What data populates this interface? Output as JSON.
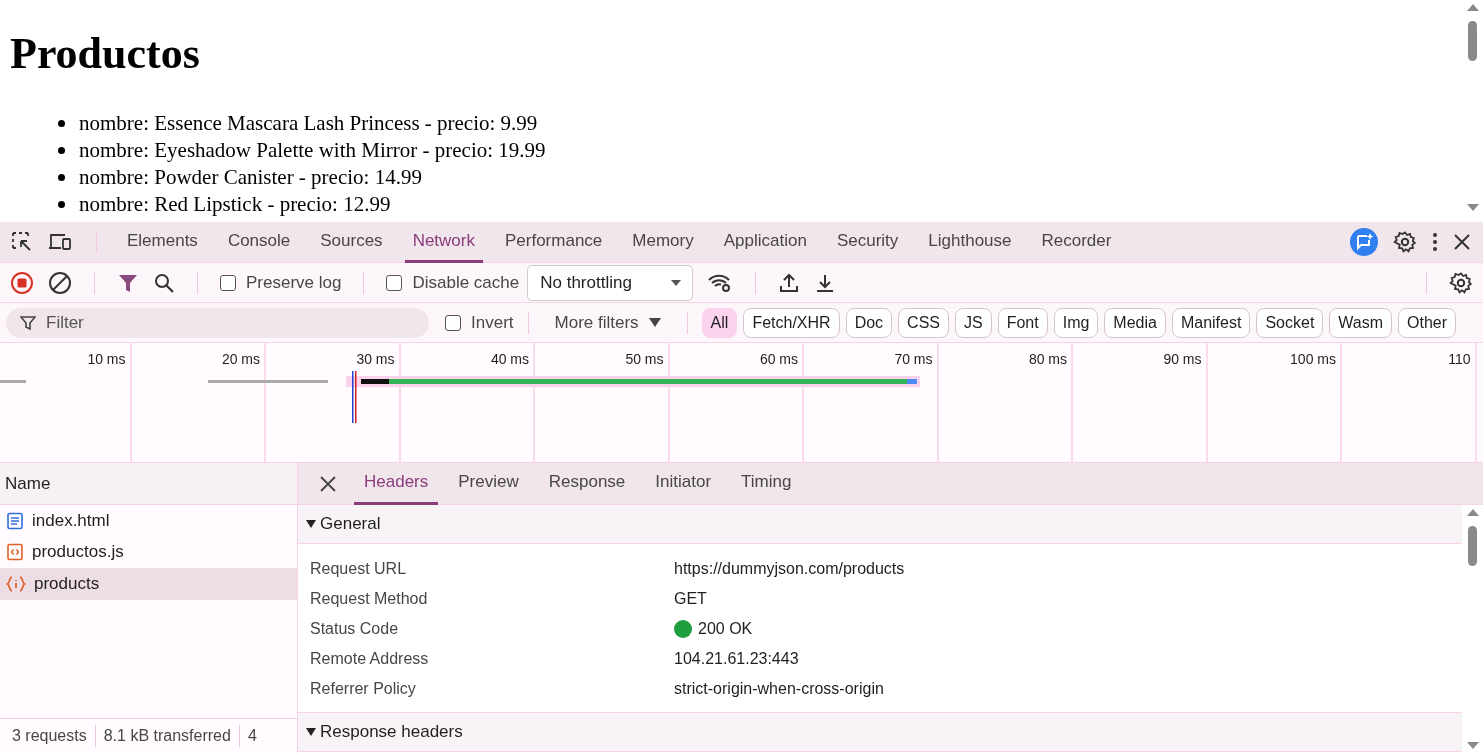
{
  "page": {
    "title": "Productos",
    "items": [
      "nombre: Essence Mascara Lash Princess - precio: 9.99",
      "nombre: Eyeshadow Palette with Mirror - precio: 19.99",
      "nombre: Powder Canister - precio: 14.99",
      "nombre: Red Lipstick - precio: 12.99"
    ]
  },
  "devtools": {
    "tabs": [
      {
        "label": "Elements",
        "selected": false
      },
      {
        "label": "Console",
        "selected": false
      },
      {
        "label": "Sources",
        "selected": false
      },
      {
        "label": "Network",
        "selected": true
      },
      {
        "label": "Performance",
        "selected": false
      },
      {
        "label": "Memory",
        "selected": false
      },
      {
        "label": "Application",
        "selected": false
      },
      {
        "label": "Security",
        "selected": false
      },
      {
        "label": "Lighthouse",
        "selected": false
      },
      {
        "label": "Recorder",
        "selected": false
      }
    ],
    "toolbar": {
      "recording": true,
      "preserve_log": {
        "label": "Preserve log",
        "checked": false
      },
      "disable_cache": {
        "label": "Disable cache",
        "checked": false
      },
      "throttling": "No throttling"
    },
    "filter": {
      "placeholder": "Filter",
      "invert": {
        "label": "Invert",
        "checked": false
      },
      "more_filters": "More filters",
      "types": [
        {
          "label": "All",
          "selected": true
        },
        {
          "label": "Fetch/XHR",
          "selected": false
        },
        {
          "label": "Doc",
          "selected": false
        },
        {
          "label": "CSS",
          "selected": false
        },
        {
          "label": "JS",
          "selected": false
        },
        {
          "label": "Font",
          "selected": false
        },
        {
          "label": "Img",
          "selected": false
        },
        {
          "label": "Media",
          "selected": false
        },
        {
          "label": "Manifest",
          "selected": false
        },
        {
          "label": "Socket",
          "selected": false
        },
        {
          "label": "Wasm",
          "selected": false
        },
        {
          "label": "Other",
          "selected": false
        }
      ]
    },
    "timeline": {
      "ticks": [
        "10 ms",
        "20 ms",
        "30 ms",
        "40 ms",
        "50 ms",
        "60 ms",
        "70 ms",
        "80 ms",
        "90 ms",
        "100 ms",
        "110"
      ]
    },
    "requests": {
      "column": "Name",
      "rows": [
        {
          "name": "index.html",
          "kind": "document",
          "selected": false
        },
        {
          "name": "productos.js",
          "kind": "script",
          "selected": false
        },
        {
          "name": "products",
          "kind": "fetch",
          "selected": true
        }
      ]
    },
    "detail": {
      "tabs": [
        {
          "label": "Headers",
          "selected": true
        },
        {
          "label": "Preview",
          "selected": false
        },
        {
          "label": "Response",
          "selected": false
        },
        {
          "label": "Initiator",
          "selected": false
        },
        {
          "label": "Timing",
          "selected": false
        }
      ],
      "sections": [
        {
          "title": "General",
          "expanded": true,
          "rows": [
            {
              "key": "Request URL",
              "value": "https://dummyjson.com/products"
            },
            {
              "key": "Request Method",
              "value": "GET"
            },
            {
              "key": "Status Code",
              "value": "200 OK",
              "color": "#1e9e3e"
            },
            {
              "key": "Remote Address",
              "value": "104.21.61.23:443"
            },
            {
              "key": "Referrer Policy",
              "value": "strict-origin-when-cross-origin"
            }
          ]
        },
        {
          "title": "Response headers",
          "expanded": true
        }
      ]
    },
    "status_bar": [
      "3 requests",
      "8.1 kB transferred",
      "4"
    ]
  }
}
